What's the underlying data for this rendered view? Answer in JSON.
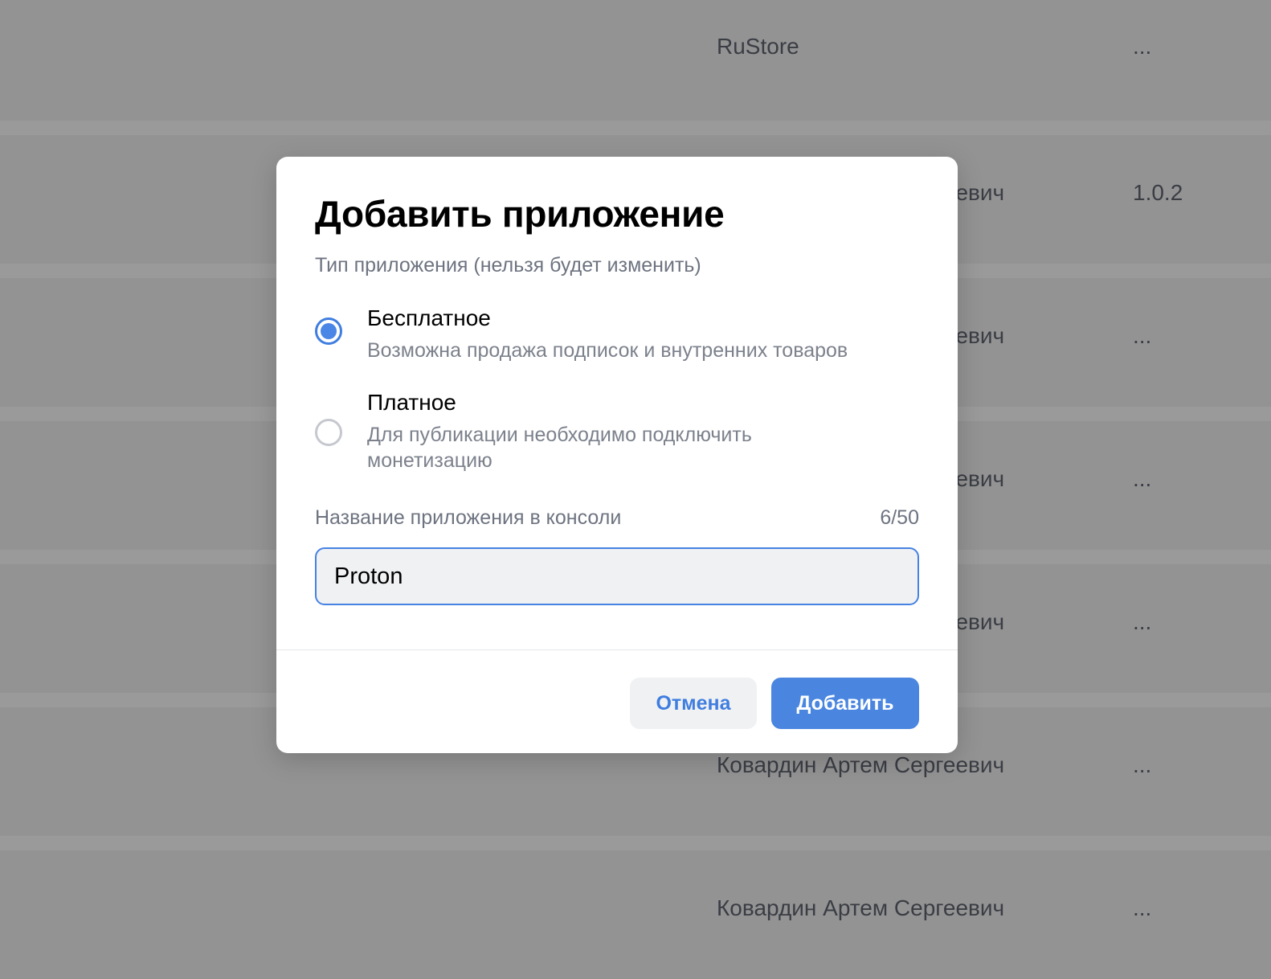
{
  "background_table": {
    "rows": [
      {
        "name": "RuStore",
        "version": "..."
      },
      {
        "name": "Ковардин Артем Сергеевич",
        "version": "1.0.2"
      },
      {
        "name": "Ковардин Артем Сергеевич",
        "version": "..."
      },
      {
        "name": "Ковардин Артем Сергеевич",
        "version": "..."
      },
      {
        "name": "Ковардин Артем Сергеевич",
        "version": "..."
      },
      {
        "name": "Ковардин Артем Сергеевич",
        "version": "..."
      },
      {
        "name": "Ковардин Артем Сергеевич",
        "version": "..."
      }
    ]
  },
  "modal": {
    "title": "Добавить приложение",
    "type_label": "Тип приложения (нельзя будет изменить)",
    "options": [
      {
        "title": "Бесплатное",
        "description": "Возможна продажа подписок и внутренних товаров",
        "selected": true
      },
      {
        "title": "Платное",
        "description": "Для публикации необходимо подключить монетизацию",
        "selected": false
      }
    ],
    "name_field": {
      "label": "Название приложения в консоли",
      "counter": "6/50",
      "value": "Proton"
    },
    "cancel_label": "Отмена",
    "add_label": "Добавить"
  },
  "colors": {
    "accent": "#4a86e0",
    "overlay_bg": "#939393"
  }
}
